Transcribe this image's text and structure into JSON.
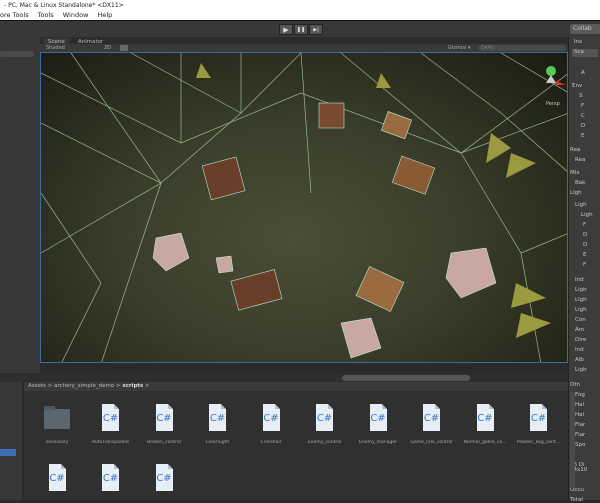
{
  "window": {
    "title": "- PC, Mac & Linux Standalone* <DX11>"
  },
  "menu": [
    "ore Tools",
    "Tools",
    "Window",
    "Help"
  ],
  "toolbar": {
    "play": "▶",
    "pause": "❚❚",
    "step": "▶|",
    "collab": "Collab"
  },
  "scene": {
    "tabs": [
      "Scene",
      "Animator"
    ],
    "shading": "Shaded",
    "mode_2d": "2D",
    "gizmos": "Gizmos ▾",
    "search": "Q▾All",
    "persp": "Persp"
  },
  "inspector": {
    "title": "Ins",
    "tab": "Sca",
    "labels": [
      "A",
      "Env",
      "S",
      "F",
      "C",
      "D",
      "E",
      "Rea",
      "Rea",
      "Mix",
      "Bak",
      "Ligh",
      "Ligh",
      "Ligh",
      "F",
      "D",
      "D",
      "E",
      "F",
      "Ind",
      "Ligh",
      "Ligh",
      "Ligh",
      "Con",
      "Am",
      "Dire",
      "Ind",
      "Alb",
      "Ligh",
      "Oth",
      "Fog",
      "Hal",
      "Hal",
      "Flar",
      "Flar",
      "Spo",
      "16 Di",
      "14x10",
      "Occu",
      "Total"
    ]
  },
  "project": {
    "breadcrumb": [
      "Assets",
      "archery_simple_demo",
      "scripts"
    ],
    "items": [
      {
        "name": "necessary",
        "type": "folder"
      },
      {
        "name": "AutoTransparent",
        "type": "cs"
      },
      {
        "name": "Broken_control",
        "type": "cs"
      },
      {
        "name": "ClearSight",
        "type": "cs"
      },
      {
        "name": "Crosshair",
        "type": "cs"
      },
      {
        "name": "Enemy_control",
        "type": "cs"
      },
      {
        "name": "Enemy_manager",
        "type": "cs"
      },
      {
        "name": "Game_role_control",
        "type": "cs"
      },
      {
        "name": "Normal_game_co...",
        "type": "cs"
      },
      {
        "name": "Powder_keg_cont...",
        "type": "cs"
      },
      {
        "name": "",
        "type": "cs"
      },
      {
        "name": "",
        "type": "cs"
      },
      {
        "name": "",
        "type": "cs"
      }
    ]
  }
}
